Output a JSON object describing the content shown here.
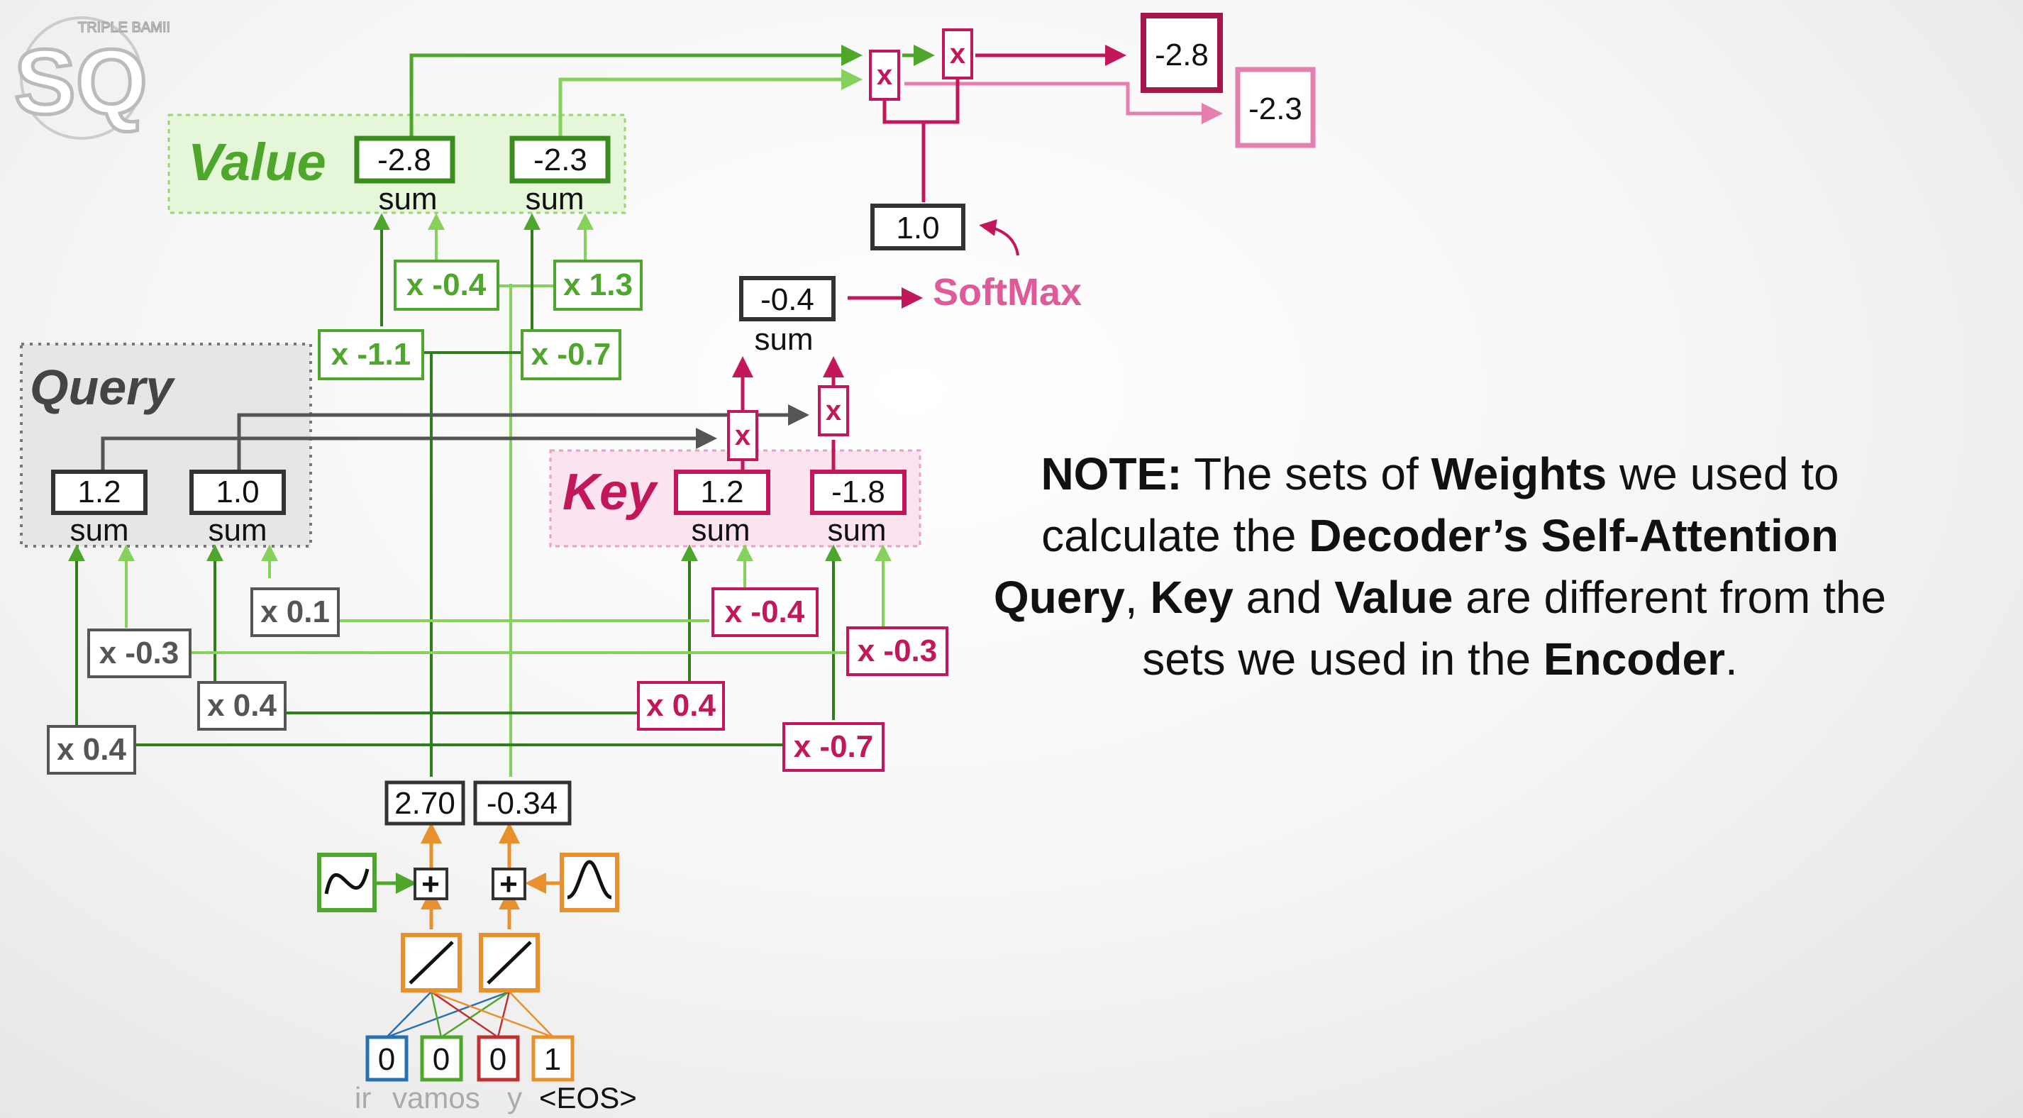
{
  "logo": {
    "text": "SQ",
    "small_text": "TRIPLE BAM!!"
  },
  "colors": {
    "value": "#4ea62a",
    "value_light": "#86d05c",
    "query": "#555555",
    "query_dark": "#333333",
    "key": "#c2185b",
    "key_light": "#e57fb0",
    "orange": "#e8902c",
    "blue": "#2a6fb0",
    "red": "#c03030",
    "text": "#111111"
  },
  "value": {
    "title": "Value",
    "outputs": [
      "-2.8",
      "-2.3"
    ],
    "sum_label": "sum",
    "weights": [
      "x -0.4",
      "x 1.3",
      "x -1.1",
      "x -0.7"
    ]
  },
  "query": {
    "title": "Query",
    "outputs": [
      "1.2",
      "1.0"
    ],
    "sum_label": "sum",
    "weights": [
      "x 0.1",
      "x -0.3",
      "x 0.4",
      "x 0.4"
    ]
  },
  "key": {
    "title": "Key",
    "outputs": [
      "1.2",
      "-1.8"
    ],
    "sum_label": "sum",
    "weights": [
      "x -0.4",
      "x -0.3",
      "x 0.4",
      "x -0.7"
    ]
  },
  "attention": {
    "mult_label": "x",
    "score": "-0.4",
    "score_sum": "sum",
    "softmax_label": "SoftMax",
    "softmax_out": "1.0",
    "result_top": "-2.8",
    "result_bottom": "-2.3"
  },
  "encoding": {
    "values": [
      "2.70",
      "-0.34"
    ],
    "plus": "+"
  },
  "inputs": {
    "values": [
      "0",
      "0",
      "0",
      "1"
    ],
    "words": [
      "ir",
      "vamos",
      "y",
      "<EOS>"
    ]
  },
  "note": {
    "p1": "NOTE:",
    "p2": " The sets of ",
    "p3": "Weights",
    "p4": " we used to calculate the ",
    "p5": "Decoder’s Self-Attention Query",
    "p6": ", ",
    "p7": "Key",
    "p8": " and ",
    "p9": "Value",
    "p10": " are different from the sets we used in the ",
    "p11": "Encoder",
    "p12": "."
  }
}
